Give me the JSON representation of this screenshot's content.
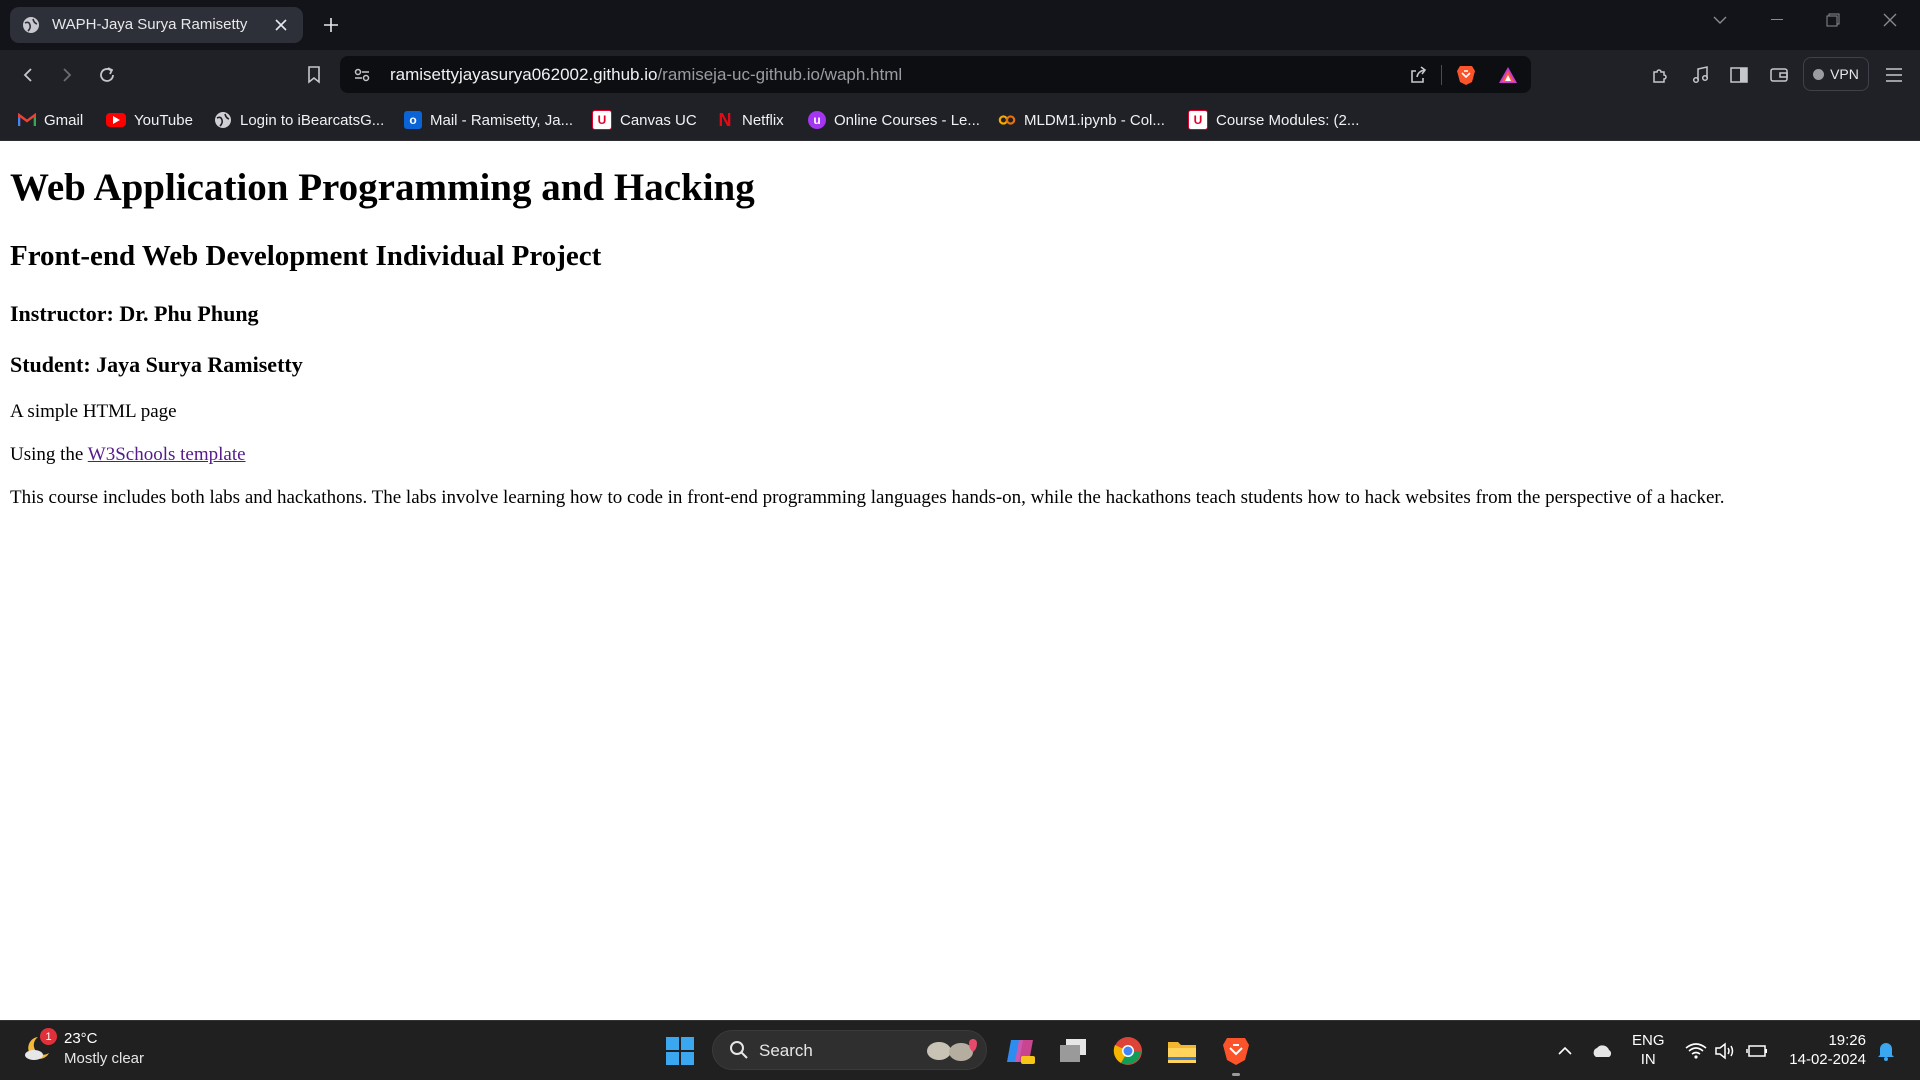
{
  "browser": {
    "tab_title": "WAPH-Jaya Surya Ramisetty",
    "url_host": "ramisettyjayasurya062002.github.io",
    "url_path": "/ramiseja-uc-github.io/waph.html",
    "vpn_label": "VPN"
  },
  "bookmarks": [
    {
      "label": "Gmail",
      "icon": "gmail-icon",
      "color": "#ea4335"
    },
    {
      "label": "YouTube",
      "icon": "youtube-icon",
      "color": "#ff0000"
    },
    {
      "label": "Login to iBearcatsG...",
      "icon": "globe-icon",
      "color": "#cfcfd4"
    },
    {
      "label": "Mail - Ramisetty, Ja...",
      "icon": "outlook-icon",
      "color": "#0a64d6"
    },
    {
      "label": "Canvas UC",
      "icon": "uc-icon",
      "color": "#e0002a"
    },
    {
      "label": "Netflix",
      "icon": "netflix-icon",
      "color": "#e50914"
    },
    {
      "label": "Online Courses - Le...",
      "icon": "udemy-icon",
      "color": "#a435f0"
    },
    {
      "label": "MLDM1.ipynb - Col...",
      "icon": "colab-icon",
      "color": "#f9ab00"
    },
    {
      "label": "Course Modules: (2...",
      "icon": "uc-icon",
      "color": "#e0002a"
    }
  ],
  "page": {
    "h1": "Web Application Programming and Hacking",
    "h2": "Front-end Web Development Individual Project",
    "instructor": "Instructor: Dr. Phu Phung",
    "student": "Student: Jaya Surya Ramisetty",
    "p1": "A simple HTML page",
    "p2_prefix": "Using the ",
    "p2_link": "W3Schools template",
    "p3": "This course includes both labs and hackathons. The labs involve learning how to code in front-end programming languages hands-on, while the hackathons teach students how to hack websites from the perspective of a hacker."
  },
  "taskbar": {
    "temp": "23°C",
    "condition": "Mostly clear",
    "weather_badge": "1",
    "search_label": "Search",
    "lang_line1": "ENG",
    "lang_line2": "IN",
    "time": "19:26",
    "date": "14-02-2024"
  }
}
